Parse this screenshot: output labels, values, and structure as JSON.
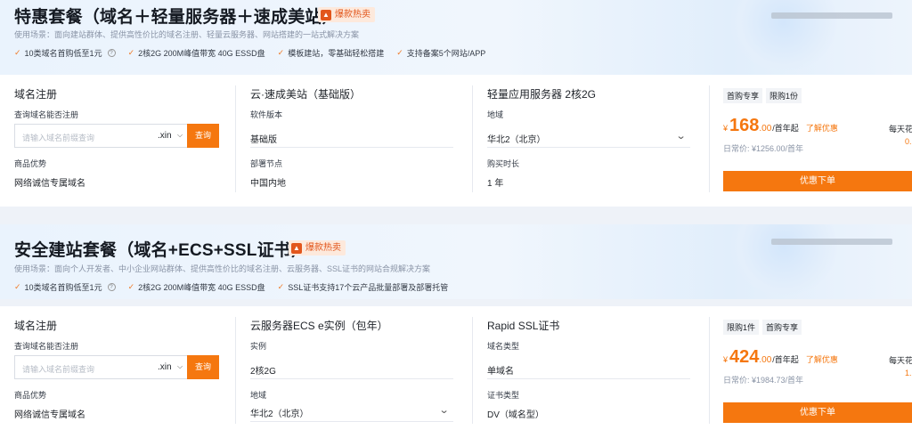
{
  "accent_color": "#f5770f",
  "packages": [
    {
      "title": "特惠套餐（域名＋轻量服务器＋速成美站）",
      "hot_badge": "爆款热卖",
      "description": "使用场景：面向建站群体、提供高性价比的域名注册、轻量云服务器、网站搭建的一站式解决方案",
      "features": [
        "10类域名首购低至1元",
        "2核2G 200M峰值带宽 40G ESSD盘",
        "模板建站，零基础轻松搭建",
        "支持备案5个网站/APP"
      ],
      "col1": {
        "heading": "域名注册",
        "query_label": "查询域名能否注册",
        "search_placeholder": "请输入域名前缀查询",
        "tld": ".xin",
        "query_button": "查询",
        "advantage_label": "商品优势",
        "advantage_value": "网络诚信专属域名"
      },
      "col2": {
        "heading": "云·速成美站（基础版）",
        "f1_label": "软件版本",
        "f1_value": "基础版",
        "f2_label": "部署节点",
        "f2_value": "中国内地"
      },
      "col3": {
        "heading": "轻量应用服务器 2核2G",
        "f1_label": "地域",
        "f1_value": "华北2（北京）",
        "f2_label": "购买时长",
        "f2_value": "1 年"
      },
      "buy": {
        "tags": [
          "首购专享",
          "限购1份"
        ],
        "currency": "¥",
        "price_int": "168",
        "price_dec": ".00",
        "unit": "/首年起",
        "promo_link": "了解优惠",
        "daily_price": "日常价: ¥1256.00/首年",
        "cut_text": "每天花",
        "cut_text2": "0.",
        "order_button": "优惠下单"
      }
    },
    {
      "title": "安全建站套餐（域名+ECS+SSL证书）",
      "hot_badge": "爆款热卖",
      "description": "使用场景：面向个人开发者、中小企业网站群体、提供高性价比的域名注册、云服务器、SSL证书的网站合规解决方案",
      "features": [
        "10类域名首购低至1元",
        "2核2G 200M峰值带宽 40G ESSD盘",
        "SSL证书支持17个云产品批量部署及部署托管"
      ],
      "col1": {
        "heading": "域名注册",
        "query_label": "查询域名能否注册",
        "search_placeholder": "请输入域名前缀查询",
        "tld": ".xin",
        "query_button": "查询",
        "advantage_label": "商品优势",
        "advantage_value": "网络诚信专属域名"
      },
      "col2": {
        "heading": "云服务器ECS e实例（包年）",
        "f1_label": "实例",
        "f1_value": "2核2G",
        "f2_label": "地域",
        "f2_value": "华北2（北京）"
      },
      "col3": {
        "heading": "Rapid SSL证书",
        "f1_label": "域名类型",
        "f1_value": "单域名",
        "f2_label": "证书类型",
        "f2_value": "DV（域名型）"
      },
      "buy": {
        "tags": [
          "限购1件",
          "首购专享"
        ],
        "currency": "¥",
        "price_int": "424",
        "price_dec": ".00",
        "unit": "/首年起",
        "promo_link": "了解优惠",
        "daily_price": "日常价: ¥1984.73/首年",
        "cut_text": "每天花",
        "cut_text2": "1.",
        "order_button": "优惠下单"
      }
    }
  ]
}
